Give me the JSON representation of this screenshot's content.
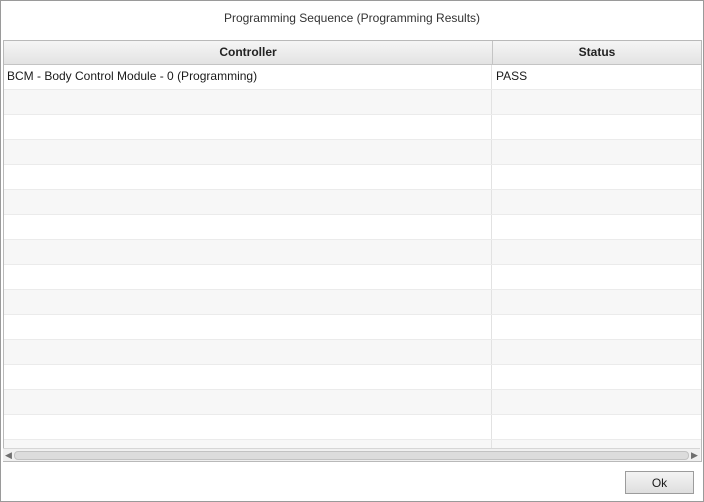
{
  "window": {
    "title": "Programming Sequence (Programming Results)"
  },
  "table": {
    "columns": [
      "Controller",
      "Status"
    ],
    "rows": [
      {
        "controller": "BCM - Body Control Module - 0 (Programming)",
        "status": "PASS"
      },
      {
        "controller": "",
        "status": ""
      },
      {
        "controller": "",
        "status": ""
      },
      {
        "controller": "",
        "status": ""
      },
      {
        "controller": "",
        "status": ""
      },
      {
        "controller": "",
        "status": ""
      },
      {
        "controller": "",
        "status": ""
      },
      {
        "controller": "",
        "status": ""
      },
      {
        "controller": "",
        "status": ""
      },
      {
        "controller": "",
        "status": ""
      },
      {
        "controller": "",
        "status": ""
      },
      {
        "controller": "",
        "status": ""
      },
      {
        "controller": "",
        "status": ""
      },
      {
        "controller": "",
        "status": ""
      },
      {
        "controller": "",
        "status": ""
      },
      {
        "controller": "",
        "status": ""
      }
    ]
  },
  "buttons": {
    "ok_label": "Ok"
  },
  "icons": {
    "scroll_left": "chevron-left-icon",
    "scroll_right": "chevron-right-icon"
  }
}
